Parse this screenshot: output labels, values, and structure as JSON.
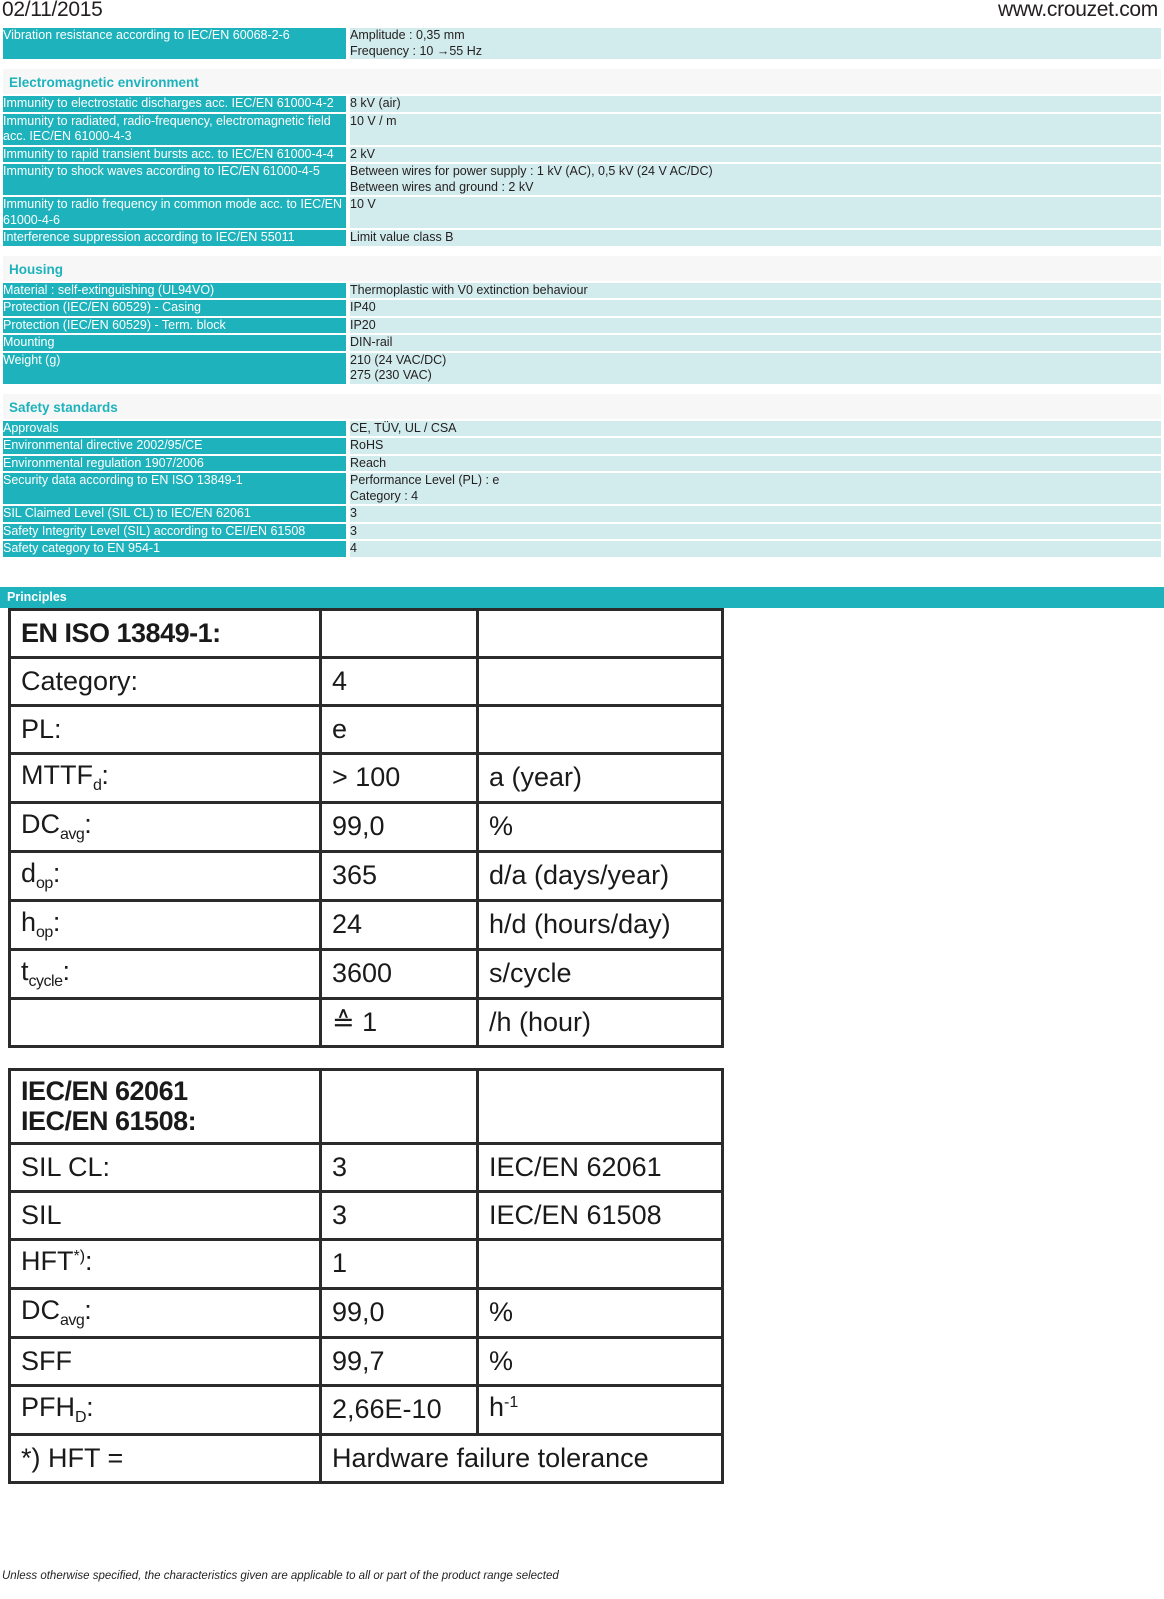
{
  "header": {
    "date": "02/11/2015",
    "url": "www.crouzet.com"
  },
  "colors": {
    "label_bg": "#1eb3bc",
    "value_bg": "#d2ebec",
    "section_text": "#1eb3bc",
    "banner_bg": "#1eb3bc"
  },
  "spec_rows": [
    {
      "type": "row",
      "label": "Vibration resistance according to IEC/EN 60068-2-6",
      "value_lines": [
        "Amplitude : 0,35 mm",
        "Frequency : 10 →55 Hz"
      ]
    },
    {
      "type": "section",
      "title": "Electromagnetic environment"
    },
    {
      "type": "row",
      "label": "Immunity to electrostatic discharges acc. IEC/EN 61000-4-2",
      "value_lines": [
        "8 kV (air)"
      ],
      "value_middle": true
    },
    {
      "type": "row",
      "label": "Immunity to radiated, radio-frequency, electromagnetic field acc. IEC/EN 61000-4-3",
      "value_lines": [
        "10 V / m"
      ],
      "value_middle": true
    },
    {
      "type": "row",
      "label": "Immunity to rapid transient bursts acc. to IEC/EN 61000-4-4",
      "value_lines": [
        "2 kV"
      ],
      "value_middle": true
    },
    {
      "type": "row",
      "label": "Immunity to shock waves according to IEC/EN 61000-4-5",
      "value_lines": [
        "Between wires for power supply : 1 kV (AC), 0,5 kV (24 V AC/DC)",
        "Between wires and ground : 2 kV"
      ]
    },
    {
      "type": "row",
      "label": "Immunity to radio frequency in common mode acc. to IEC/EN 61000-4-6",
      "value_lines": [
        "10 V"
      ],
      "value_middle": true
    },
    {
      "type": "row",
      "label": "Interference suppression according to IEC/EN 55011",
      "value_lines": [
        "Limit value class B"
      ]
    },
    {
      "type": "section",
      "title": "Housing"
    },
    {
      "type": "row",
      "label": "Material : self-extinguishing (UL94VO)",
      "value_lines": [
        "Thermoplastic with V0 extinction behaviour"
      ]
    },
    {
      "type": "row",
      "label": "Protection (IEC/EN 60529) - Casing",
      "value_lines": [
        "IP40"
      ]
    },
    {
      "type": "row",
      "label": "Protection (IEC/EN 60529) - Term. block",
      "value_lines": [
        "IP20"
      ]
    },
    {
      "type": "row",
      "label": "Mounting",
      "value_lines": [
        "DIN-rail"
      ]
    },
    {
      "type": "row",
      "label": "Weight (g)",
      "value_lines": [
        "210 (24 VAC/DC)",
        "275 (230 VAC)"
      ]
    },
    {
      "type": "section",
      "title": "Safety standards"
    },
    {
      "type": "row",
      "label": "Approvals",
      "value_lines": [
        "CE, TÜV, UL / CSA"
      ]
    },
    {
      "type": "row",
      "label": "Environmental directive 2002/95/CE",
      "value_lines": [
        "RoHS"
      ]
    },
    {
      "type": "row",
      "label": "Environmental regulation 1907/2006",
      "value_lines": [
        "Reach"
      ]
    },
    {
      "type": "row",
      "label": "Security data according to EN ISO 13849-1",
      "value_lines": [
        "Performance Level (PL)  : e",
        "Category : 4"
      ]
    },
    {
      "type": "row",
      "label": "SIL Claimed Level (SIL CL) to IEC/EN 62061",
      "value_lines": [
        "3"
      ]
    },
    {
      "type": "row",
      "label": "Safety Integrity Level (SIL) according to CEI/EN 61508",
      "value_lines": [
        "3"
      ]
    },
    {
      "type": "row",
      "label": "Safety category to EN 954-1",
      "value_lines": [
        "4"
      ]
    }
  ],
  "principles": {
    "banner_label": "Principles",
    "table_1": {
      "header": "EN ISO 13849-1:",
      "rows": [
        {
          "label": "Category:",
          "label_sub": "",
          "value": "4",
          "unit": ""
        },
        {
          "label": "PL:",
          "label_sub": "",
          "value": "e",
          "unit": ""
        },
        {
          "label": "MTTF",
          "label_sub": "d",
          "label_suffix": ":",
          "value": "> 100",
          "unit": "a (year)"
        },
        {
          "label": "DC",
          "label_sub": "avg",
          "label_suffix": ":",
          "value": "99,0",
          "unit": "%"
        },
        {
          "label": "d",
          "label_sub": "op",
          "label_suffix": ":",
          "value": "365",
          "unit": "d/a (days/year)"
        },
        {
          "label": "h",
          "label_sub": "op",
          "label_suffix": ":",
          "value": "24",
          "unit": "h/d (hours/day)"
        },
        {
          "label": "t",
          "label_sub": "cycle",
          "label_suffix": ":",
          "value": "3600",
          "unit": "s/cycle"
        },
        {
          "label": "",
          "label_sub": "",
          "label_suffix": "",
          "value": "≙ 1",
          "unit": "/h (hour)"
        }
      ]
    },
    "table_2": {
      "header_line_1": "IEC/EN 62061",
      "header_line_2": "IEC/EN 61508:",
      "rows": [
        {
          "label": "SIL CL:",
          "label_sub": "",
          "value": "3",
          "unit": "IEC/EN 62061"
        },
        {
          "label": "SIL",
          "label_sub": "",
          "value": "3",
          "unit": "IEC/EN 61508"
        },
        {
          "label": "HFT",
          "label_sup": "*)",
          "label_suffix": ":",
          "value": "1",
          "unit": ""
        },
        {
          "label": "DC",
          "label_sub": "avg",
          "label_suffix": ":",
          "value": "99,0",
          "unit": "%"
        },
        {
          "label": "SFF",
          "label_sub": "",
          "value": "99,7",
          "unit": "%"
        },
        {
          "label": "PFH",
          "label_sub": "D",
          "label_suffix": ":",
          "value": "2,66E-10",
          "unit": "h-1",
          "unit_sup": "-1",
          "unit_base": "h"
        }
      ],
      "footnote_marker": "*) HFT =",
      "footnote_text": "Hardware failure tolerance"
    }
  },
  "footer": {
    "note": "Unless otherwise specified, the characteristics given are applicable to all or part of the product range selected"
  }
}
